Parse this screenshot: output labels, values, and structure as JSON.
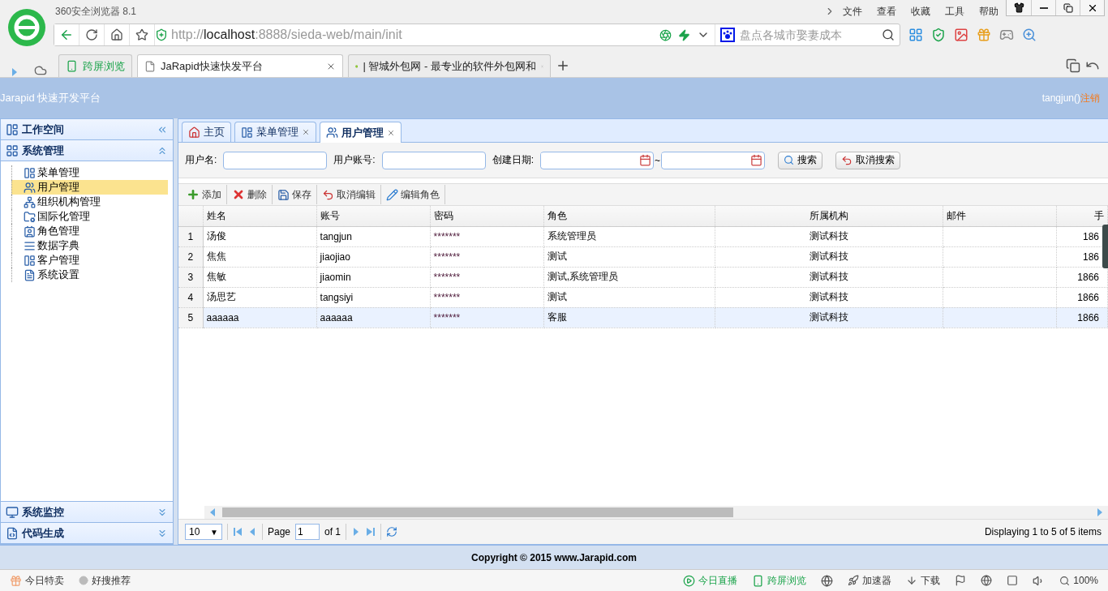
{
  "browser": {
    "title": "360安全浏览器 8.1",
    "menu": [
      "文件",
      "查看",
      "收藏",
      "工具",
      "帮助"
    ],
    "url": {
      "scheme": "http://",
      "host": "localhost",
      "path": ":8888/sieda-web/main/init"
    },
    "search": {
      "placeholder": "盘点各城市娶妻成本"
    },
    "cross_screen": "跨屏浏览",
    "tabs": [
      {
        "title": "JaRapid快速快发平台",
        "selected": true
      },
      {
        "title": "| 智城外包网 - 最专业的软件外包网和",
        "selected": false
      }
    ]
  },
  "app": {
    "brand": "Jarapid 快速开发平台",
    "user": "tangjun()",
    "logout": "注销",
    "sidebar": [
      {
        "title": "工作空间"
      },
      {
        "title": "系统管理",
        "expanded": true,
        "items": [
          {
            "label": "菜单管理",
            "selected": false
          },
          {
            "label": "用户管理",
            "selected": true
          },
          {
            "label": "组织机构管理",
            "selected": false
          },
          {
            "label": "国际化管理",
            "selected": false
          },
          {
            "label": "角色管理",
            "selected": false
          },
          {
            "label": "数据字典",
            "selected": false
          },
          {
            "label": "客户管理",
            "selected": false
          },
          {
            "label": "系统设置",
            "selected": false
          }
        ]
      },
      {
        "title": "系统监控",
        "expanded": false
      },
      {
        "title": "代码生成",
        "expanded": false
      }
    ],
    "tabs": [
      {
        "label": "主页",
        "closable": false,
        "selected": false
      },
      {
        "label": "菜单管理",
        "closable": true,
        "selected": false
      },
      {
        "label": "用户管理",
        "closable": true,
        "selected": true
      }
    ],
    "filters": {
      "username": "用户名:",
      "account": "用户账号:",
      "date": "创建日期:",
      "range": "~",
      "search": "搜索",
      "cancel": "取消搜索"
    },
    "toolbar": [
      "添加",
      "删除",
      "保存",
      "取消编辑",
      "编辑角色"
    ],
    "table": {
      "columns": [
        "姓名",
        "账号",
        "密码",
        "角色",
        "所属机构",
        "邮件",
        "手"
      ],
      "rows": [
        {
          "num": "1",
          "cells": [
            "汤俊",
            "tangjun",
            "*******",
            "系统管理员",
            "测试科技",
            "",
            "186"
          ],
          "selected": false
        },
        {
          "num": "2",
          "cells": [
            "焦焦",
            "jiaojiao",
            "*******",
            "测试",
            "测试科技",
            "",
            "186"
          ],
          "selected": false
        },
        {
          "num": "3",
          "cells": [
            "焦敏",
            "jiaomin",
            "*******",
            "测试,系统管理员",
            "测试科技",
            "",
            "1866"
          ],
          "selected": false
        },
        {
          "num": "4",
          "cells": [
            "汤思艺",
            "tangsiyi",
            "*******",
            "测试",
            "测试科技",
            "",
            "1866"
          ],
          "selected": false
        },
        {
          "num": "5",
          "cells": [
            "aaaaaa",
            "aaaaaa",
            "*******",
            "客服",
            "测试科技",
            "",
            "1866"
          ],
          "selected": true
        }
      ]
    },
    "pager": {
      "page_size": "10",
      "caret": "▼",
      "page_label": "Page",
      "page": "1",
      "of": "of 1",
      "info": "Displaying 1 to 5 of 5 items"
    },
    "footer": "Copyright © 2015 www.Jarapid.com"
  },
  "status_bar": {
    "left": [
      "今日特卖",
      "好搜推荐"
    ],
    "right": [
      "今日直播",
      "跨屏浏览",
      "加速器",
      "下载"
    ],
    "zoom": "100%"
  }
}
